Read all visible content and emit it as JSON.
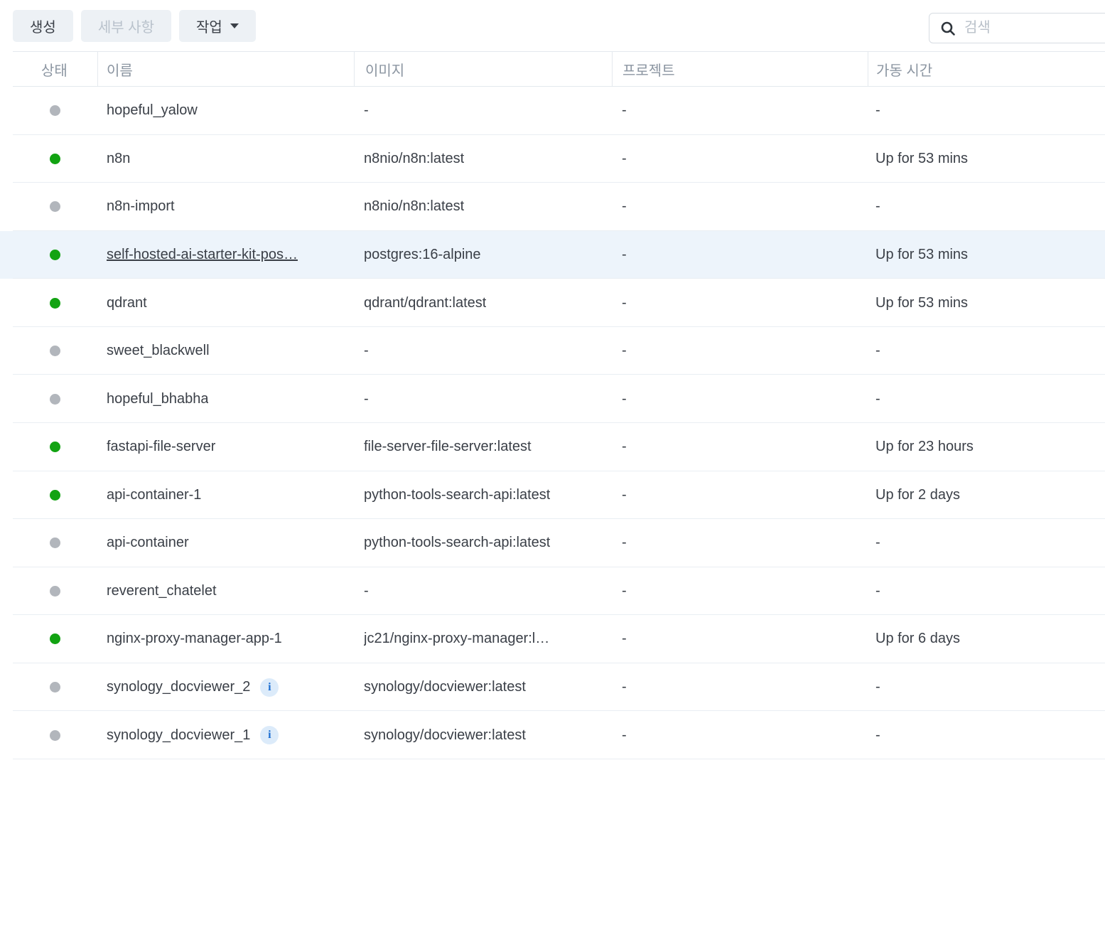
{
  "toolbar": {
    "create_label": "생성",
    "details_label": "세부 사항",
    "action_label": "작업",
    "search_placeholder": "검색"
  },
  "icons": {
    "search": "magnifier",
    "action_caret": "chevron-down",
    "info_glyph": "i"
  },
  "colors": {
    "running": "#12a312",
    "stopped": "#b2b6bc",
    "highlight_row_bg": "#edf4fb",
    "accent_blue": "#1d6fd2",
    "info_badge_bg": "#dcebfa"
  },
  "table": {
    "columns": [
      {
        "key": "status",
        "label": "상태"
      },
      {
        "key": "name",
        "label": "이름"
      },
      {
        "key": "image",
        "label": "이미지"
      },
      {
        "key": "project",
        "label": "프로젝트"
      },
      {
        "key": "uptime",
        "label": "가동 시간"
      }
    ],
    "rows": [
      {
        "status": "stopped",
        "name": "hopeful_yalow",
        "image": "-",
        "project": "-",
        "uptime": "-"
      },
      {
        "status": "running",
        "name": "n8n",
        "image": "n8nio/n8n:latest",
        "project": "-",
        "uptime": "Up for 53 mins"
      },
      {
        "status": "stopped",
        "name": "n8n-import",
        "image": "n8nio/n8n:latest",
        "project": "-",
        "uptime": "-"
      },
      {
        "status": "running",
        "name": "self-hosted-ai-starter-kit-pos…",
        "image": "postgres:16-alpine",
        "project": "-",
        "uptime": "Up for 53 mins",
        "highlighted": true,
        "name_underlined": true
      },
      {
        "status": "running",
        "name": "qdrant",
        "image": "qdrant/qdrant:latest",
        "project": "-",
        "uptime": "Up for 53 mins"
      },
      {
        "status": "stopped",
        "name": "sweet_blackwell",
        "image": "-",
        "project": "-",
        "uptime": "-"
      },
      {
        "status": "stopped",
        "name": "hopeful_bhabha",
        "image": "-",
        "project": "-",
        "uptime": "-"
      },
      {
        "status": "running",
        "name": "fastapi-file-server",
        "image": "file-server-file-server:latest",
        "project": "-",
        "uptime": "Up for 23 hours"
      },
      {
        "status": "running",
        "name": "api-container-1",
        "image": "python-tools-search-api:latest",
        "project": "-",
        "uptime": "Up for 2 days"
      },
      {
        "status": "stopped",
        "name": "api-container",
        "image": "python-tools-search-api:latest",
        "project": "-",
        "uptime": "-"
      },
      {
        "status": "stopped",
        "name": "reverent_chatelet",
        "image": "-",
        "project": "-",
        "uptime": "-"
      },
      {
        "status": "running",
        "name": "nginx-proxy-manager-app-1",
        "image": "jc21/nginx-proxy-manager:l…",
        "project": "-",
        "uptime": "Up for 6 days"
      },
      {
        "status": "stopped",
        "name": "synology_docviewer_2",
        "image": "synology/docviewer:latest",
        "project": "-",
        "uptime": "-",
        "info_icon": true
      },
      {
        "status": "stopped",
        "name": "synology_docviewer_1",
        "image": "synology/docviewer:latest",
        "project": "-",
        "uptime": "-",
        "info_icon": true
      }
    ]
  }
}
